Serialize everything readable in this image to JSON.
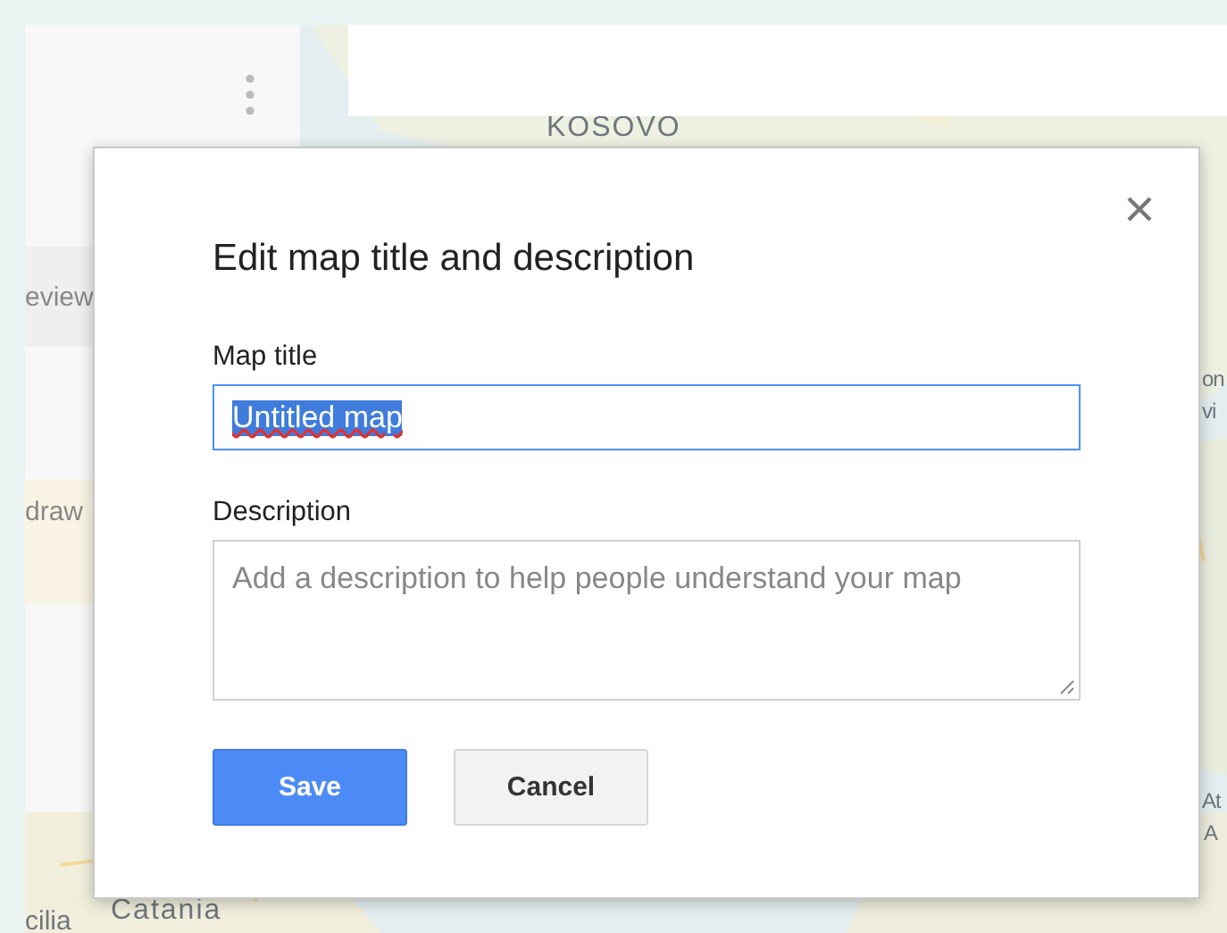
{
  "map_labels": [
    {
      "text": "KOSOVO"
    },
    {
      "text": "Catania"
    },
    {
      "text": "cilia"
    },
    {
      "text": "on"
    },
    {
      "text": "vi"
    },
    {
      "text": "At"
    },
    {
      "text": "A"
    }
  ],
  "side_panel": {
    "items": [
      {
        "text": "eview",
        "kind": "row"
      },
      {
        "text": "draw",
        "kind": "notice"
      }
    ]
  },
  "dialog": {
    "title": "Edit map title and description",
    "fields": [
      {
        "label": "Map title",
        "value": "Untitled map",
        "text_selected": true,
        "kind": "line"
      },
      {
        "label": "Description",
        "placeholder": "Add a description to help people understand your map",
        "kind": "area"
      }
    ],
    "buttons": [
      {
        "label": "Save",
        "kind": "primary"
      },
      {
        "label": "Cancel",
        "kind": "secondary"
      }
    ]
  }
}
